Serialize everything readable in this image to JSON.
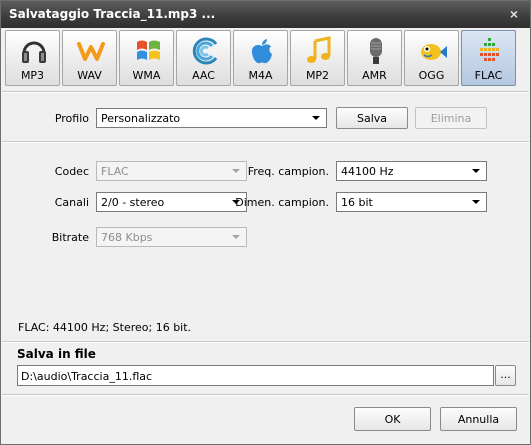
{
  "window": {
    "title": "Salvataggio Traccia_11.mp3 ...",
    "close_glyph": "×"
  },
  "formats": [
    {
      "label": "MP3",
      "icon": "headphones-icon"
    },
    {
      "label": "WAV",
      "icon": "wav-icon"
    },
    {
      "label": "WMA",
      "icon": "windows-flag-icon"
    },
    {
      "label": "AAC",
      "icon": "aac-waves-icon"
    },
    {
      "label": "M4A",
      "icon": "apple-icon"
    },
    {
      "label": "MP2",
      "icon": "music-note-icon"
    },
    {
      "label": "AMR",
      "icon": "microphone-icon"
    },
    {
      "label": "OGG",
      "icon": "fish-icon"
    },
    {
      "label": "FLAC",
      "icon": "flac-bars-icon",
      "selected": true
    }
  ],
  "profile": {
    "label": "Profilo",
    "value": "Personalizzato",
    "save_label": "Salva",
    "delete_label": "Elimina"
  },
  "settings": {
    "codec_label": "Codec",
    "codec_value": "FLAC",
    "channels_label": "Canali",
    "channels_value": "2/0 - stereo",
    "bitrate_label": "Bitrate",
    "bitrate_value": "768 Kbps",
    "sample_rate_label": "Freq. campion.",
    "sample_rate_value": "44100 Hz",
    "sample_size_label": "Dimen. campion.",
    "sample_size_value": "16 bit"
  },
  "info_text": "FLAC:  44100  Hz; Stereo; 16 bit.",
  "save_file": {
    "title": "Salva in file",
    "path": "D:\\audio\\Traccia_11.flac",
    "browse_label": "..."
  },
  "footer": {
    "ok_label": "OK",
    "cancel_label": "Annulla"
  },
  "colors": {
    "title_bar": "#3c3c3c",
    "selected_tab": "#c3d3e8",
    "wav_orange": "#f39a1a",
    "flac_green": "#2eaa3c"
  }
}
